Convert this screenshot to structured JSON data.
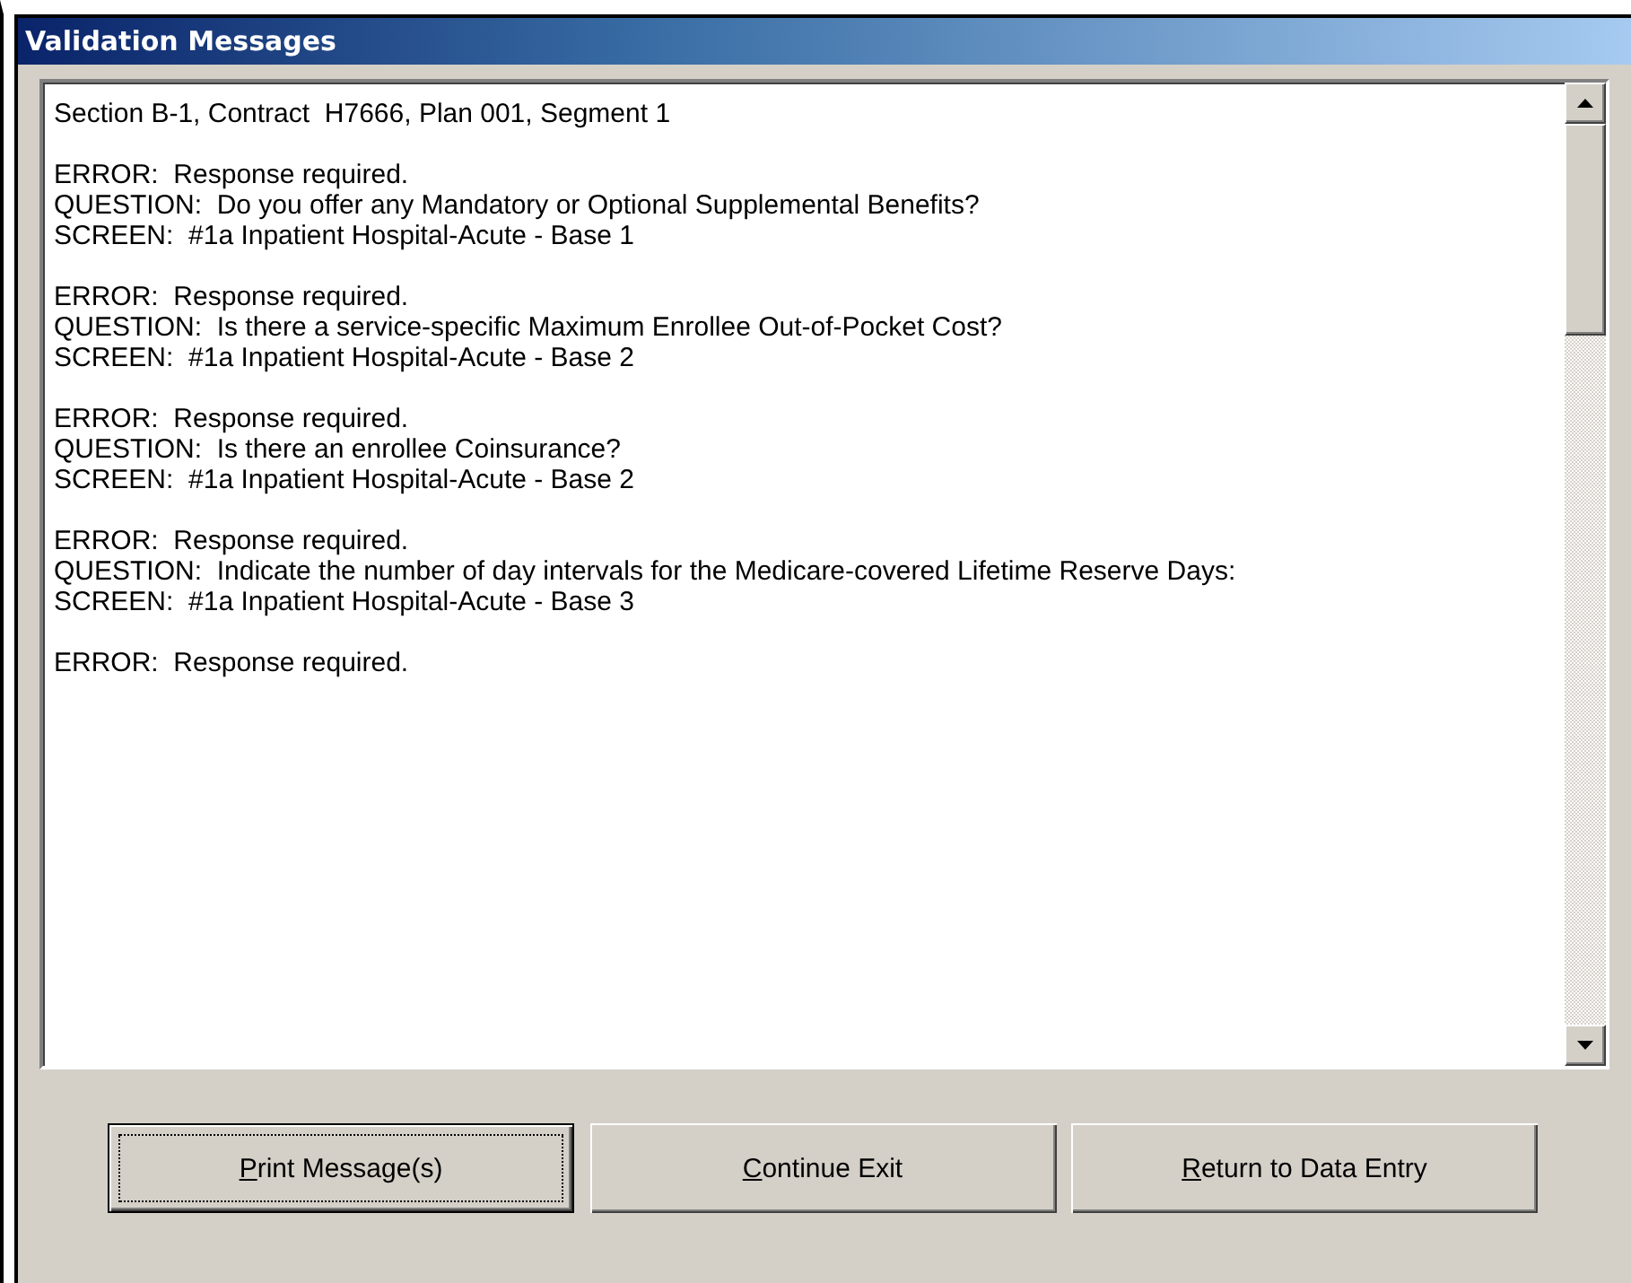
{
  "window": {
    "title": "Validation Messages"
  },
  "messages": {
    "header": "Section B-1, Contract  H7666, Plan 001, Segment 1",
    "items": [
      {
        "error": "ERROR:  Response required.",
        "question": "QUESTION:  Do you offer any Mandatory or Optional Supplemental Benefits?",
        "screen": "SCREEN:  #1a Inpatient Hospital-Acute - Base 1"
      },
      {
        "error": "ERROR:  Response required.",
        "question": "QUESTION:  Is there a service-specific Maximum Enrollee Out-of-Pocket Cost?",
        "screen": "SCREEN:  #1a Inpatient Hospital-Acute - Base 2"
      },
      {
        "error": "ERROR:  Response required.",
        "question": "QUESTION:  Is there an enrollee Coinsurance?",
        "screen": "SCREEN:  #1a Inpatient Hospital-Acute - Base 2"
      },
      {
        "error": "ERROR:  Response required.",
        "question": "QUESTION:  Indicate the number of day intervals for the Medicare-covered Lifetime Reserve Days:",
        "screen": "SCREEN:  #1a Inpatient Hospital-Acute - Base 3"
      },
      {
        "error": "ERROR:  Response required."
      }
    ]
  },
  "buttons": [
    {
      "access_key": "P",
      "label_rest": "rint Message(s)",
      "focused": true
    },
    {
      "access_key": "C",
      "label_rest": "ontinue Exit",
      "focused": false
    },
    {
      "access_key": "R",
      "label_rest": "eturn to Data Entry",
      "focused": false
    }
  ]
}
